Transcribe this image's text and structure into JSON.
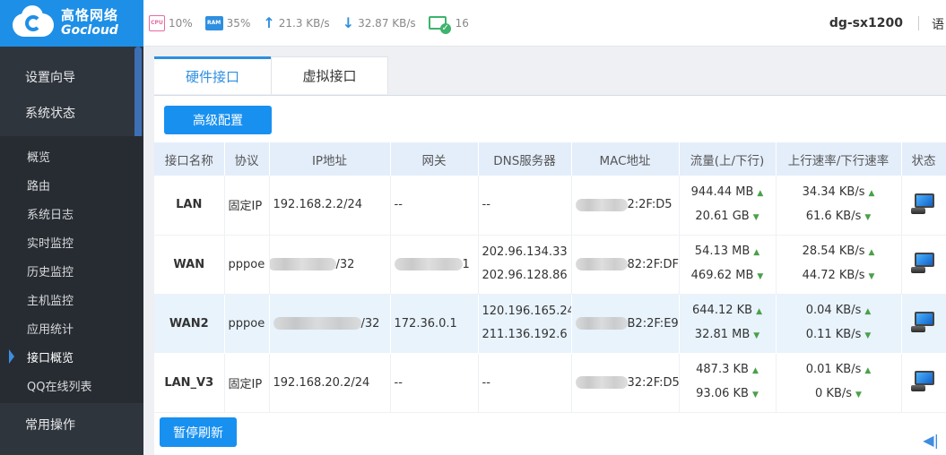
{
  "brand": {
    "cn": "高恪网络",
    "en": "Gocloud"
  },
  "topbar": {
    "cpu_label": "CPU",
    "cpu": "10%",
    "ram_label": "RAM",
    "ram": "35%",
    "upload": "21.3 KB/s",
    "download": "32.87 KB/s",
    "online_count": "16",
    "device_name": "dg-sx1200",
    "lang": "语"
  },
  "sidebar": {
    "top_items": [
      {
        "label": "设置向导"
      },
      {
        "label": "系统状态"
      }
    ],
    "sub_items": [
      {
        "label": "概览"
      },
      {
        "label": "路由"
      },
      {
        "label": "系统日志"
      },
      {
        "label": "实时监控"
      },
      {
        "label": "历史监控"
      },
      {
        "label": "主机监控"
      },
      {
        "label": "应用统计"
      },
      {
        "label": "接口概览"
      },
      {
        "label": "QQ在线列表"
      }
    ],
    "bottom_item": "常用操作",
    "active": "接口概览"
  },
  "tabs": [
    {
      "label": "硬件接口"
    },
    {
      "label": "虚拟接口"
    }
  ],
  "buttons": {
    "advanced": "高级配置",
    "pause": "暂停刷新"
  },
  "table": {
    "headers": [
      "接口名称",
      "协议",
      "IP地址",
      "网关",
      "DNS服务器",
      "MAC地址",
      "流量(上/下行)",
      "上行速率/下行速率",
      "状态"
    ],
    "rows": [
      {
        "name": "LAN",
        "protocol": "固定IP",
        "ip": "192.168.2.2/24",
        "gateway": "--",
        "dns1": "--",
        "dns2": "",
        "mac": "2:2F:D5",
        "traffic_up": "944.44 MB",
        "traffic_down": "20.61 GB",
        "rate_up": "34.34 KB/s",
        "rate_down": "61.6 KB/s"
      },
      {
        "name": "WAN",
        "protocol": "pppoe",
        "ip": "/32",
        "gateway": "1",
        "dns1": "202.96.134.33",
        "dns2": "202.96.128.86",
        "mac": "82:2F:DF",
        "traffic_up": "54.13 MB",
        "traffic_down": "469.62 MB",
        "rate_up": "28.54 KB/s",
        "rate_down": "44.72 KB/s"
      },
      {
        "name": "WAN2",
        "protocol": "pppoe",
        "ip": "/32",
        "gateway": "172.36.0.1",
        "dns1": "120.196.165.24",
        "dns2": "211.136.192.6",
        "mac": "B2:2F:E9",
        "traffic_up": "644.12 KB",
        "traffic_down": "32.81 MB",
        "rate_up": "0.04 KB/s",
        "rate_down": "0.11 KB/s"
      },
      {
        "name": "LAN_V3",
        "protocol": "固定IP",
        "ip": "192.168.20.2/24",
        "gateway": "--",
        "dns1": "--",
        "dns2": "",
        "mac": "32:2F:D5",
        "traffic_up": "487.3 KB",
        "traffic_down": "93.06 KB",
        "rate_up": "0.01 KB/s",
        "rate_down": "0 KB/s"
      }
    ]
  },
  "colors": {
    "accent": "#1890f0",
    "sidebar_bg": "#2f353d",
    "header_row": "#e4eefb",
    "highlight_row": "#e8f3fc"
  }
}
